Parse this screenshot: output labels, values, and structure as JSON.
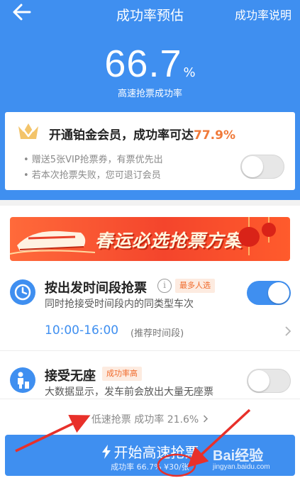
{
  "nav": {
    "title": "成功率预估",
    "right_link": "成功率说明"
  },
  "rate": {
    "value": "66.7",
    "unit": "%",
    "label": "高速抢票成功率"
  },
  "vip": {
    "title_prefix": "开通铂金会员，成功率可达",
    "title_rate": "77.9%",
    "line1": "• 赠送5张VIP抢票券，有票优先出",
    "line2": "• 若本次抢票失败，您可退订会员",
    "toggle_on": false
  },
  "banner": {
    "text": "春运必选抢票方案"
  },
  "options": [
    {
      "title": "按出发时间段抢票",
      "tag": "最多人选",
      "desc": "同时抢接受时间段内的同类型车次",
      "time_range": "10:00-16:00",
      "time_hint": "(推荐时间段)",
      "toggle_on": true
    },
    {
      "title": "接受无座",
      "tag": "成功率高",
      "desc": "大数据显示，发车前会放出大量无座票",
      "toggle_on": false
    }
  ],
  "low_speed": {
    "label": "低速抢票 成功率 21.6%"
  },
  "start": {
    "label": "开始高速抢票",
    "sub": "成功率 66.7% ¥30/张"
  },
  "watermark": {
    "main": "Bai经验",
    "sub": "jingyan.baidu.com"
  },
  "colors": {
    "primary": "#3f8ff0",
    "accent": "#f07a3a",
    "annotation": "#e8302a"
  }
}
